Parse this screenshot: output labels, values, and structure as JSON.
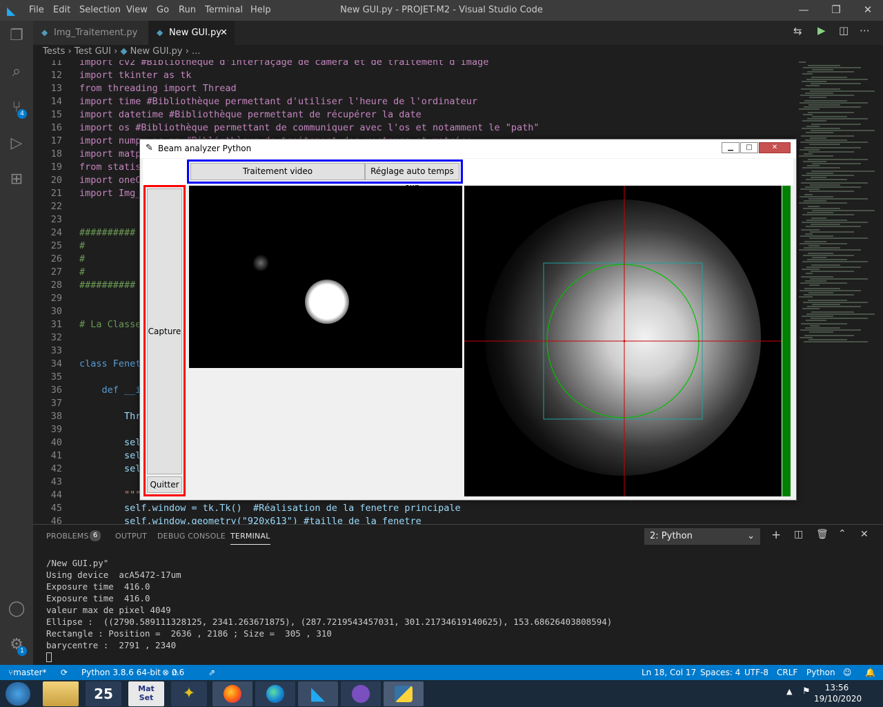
{
  "titlebar": {
    "menu": [
      "File",
      "Edit",
      "Selection",
      "View",
      "Go",
      "Run",
      "Terminal",
      "Help"
    ],
    "title": "New GUI.py - PROJET-M2 - Visual Studio Code"
  },
  "tabs": [
    {
      "label": "Img_Traitement.py"
    },
    {
      "label": "New GUI.py",
      "close": "✕"
    }
  ],
  "breadcrumb": {
    "parts": [
      "Tests",
      "Test GUI",
      "New GUI.py",
      "..."
    ]
  },
  "activity_badges": {
    "scm": "4",
    "settings": "1"
  },
  "editor": {
    "lines": [
      {
        "n": "11",
        "text": "import cv2 #Bibliothèque d'interfaçage de caméra et de traitement d'image"
      },
      {
        "n": "12",
        "text": "import tkinter as tk"
      },
      {
        "n": "13",
        "text": "from threading import Thread"
      },
      {
        "n": "14",
        "text": "import time #Bibliothèque permettant d'utiliser l'heure de l'ordinateur"
      },
      {
        "n": "15",
        "text": "import datetime #Bibliothèque permettant de récupérer la date"
      },
      {
        "n": "16",
        "text": "import os #Bibliothèque permettant de communiquer avec l'os et notamment le \"path\""
      },
      {
        "n": "17",
        "text": "import numpy as np #Bibliothèque de traitement des vecteurs et matrice"
      },
      {
        "n": "18",
        "text": "import matp"
      },
      {
        "n": "19",
        "text": "from statis"
      },
      {
        "n": "20",
        "text": "import oneC"
      },
      {
        "n": "21",
        "text": "import Img_"
      },
      {
        "n": "22",
        "text": ""
      },
      {
        "n": "23",
        "text": ""
      },
      {
        "n": "24",
        "text": "##########"
      },
      {
        "n": "25",
        "text": "#"
      },
      {
        "n": "26",
        "text": "#"
      },
      {
        "n": "27",
        "text": "#"
      },
      {
        "n": "28",
        "text": "##########"
      },
      {
        "n": "29",
        "text": ""
      },
      {
        "n": "30",
        "text": ""
      },
      {
        "n": "31",
        "text": "# La Classe"
      },
      {
        "n": "32",
        "text": ""
      },
      {
        "n": "33",
        "text": ""
      },
      {
        "n": "34",
        "text": "class Fenet"
      },
      {
        "n": "35",
        "text": ""
      },
      {
        "n": "36",
        "text": "    def __i"
      },
      {
        "n": "37",
        "text": ""
      },
      {
        "n": "38",
        "text": "        Thr"
      },
      {
        "n": "39",
        "text": ""
      },
      {
        "n": "40",
        "text": "        sel"
      },
      {
        "n": "41",
        "text": "        sel"
      },
      {
        "n": "42",
        "text": "        sel"
      },
      {
        "n": "43",
        "text": ""
      },
      {
        "n": "44",
        "text": "        \"\"\""
      },
      {
        "n": "45",
        "text": "        self.window = tk.Tk()  #Réalisation de la fenetre principale"
      },
      {
        "n": "46",
        "text": "        self.window.geometry(\"920x613\") #taille de la fenetre"
      }
    ]
  },
  "panel": {
    "tabs": [
      "PROBLEMS",
      "OUTPUT",
      "DEBUG CONSOLE",
      "TERMINAL"
    ],
    "problems_count": "6",
    "terminal_select": "2: Python",
    "terminal_lines": [
      "/New GUI.py\"",
      "Using device  acA5472-17um",
      "Exposure time  416.0",
      "Exposure time  416.0",
      "valeur max de pixel 4049",
      "Ellipse :  ((2790.589111328125, 2341.263671875), (287.7219543457031, 301.21734619140625), 153.68626403808594)",
      "Rectangle : Position =  2636 , 2186 ; Size =  305 , 310",
      "barycentre :  2791 , 2340"
    ]
  },
  "status": {
    "branch": "master*",
    "python": "Python 3.8.6 64-bit",
    "errors": "0",
    "warnings": "6",
    "position": "Ln 18, Col 17",
    "spaces": "Spaces: 4",
    "encoding": "UTF-8",
    "eol": "CRLF",
    "language": "Python"
  },
  "taskbar": {
    "time": "13:56",
    "date": "19/10/2020"
  },
  "tk_window": {
    "title": "Beam analyzer Python",
    "btn_video": "Traitement video",
    "btn_auto": "Réglage auto temps exp",
    "btn_capture": "Capture",
    "btn_quit": "Quitter"
  }
}
